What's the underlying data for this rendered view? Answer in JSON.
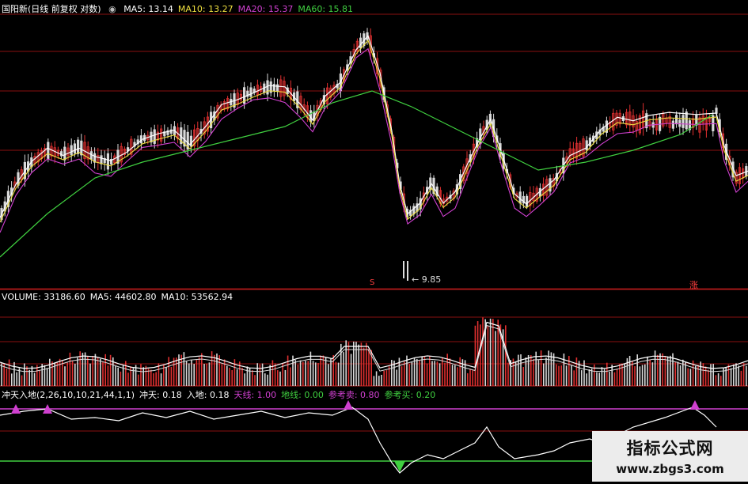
{
  "price_panel": {
    "title": "国阳新(日线 前复权 对数)",
    "ma_labels": [
      {
        "text": "MA5: 13.14",
        "color": "#ffffff"
      },
      {
        "text": "MA10: 13.27",
        "color": "#f0e040"
      },
      {
        "text": "MA20: 15.37",
        "color": "#d040d0"
      },
      {
        "text": "MA60: 15.81",
        "color": "#40d040"
      }
    ],
    "low_marker": "9.85",
    "marker_left": "S",
    "marker_right": "涨"
  },
  "volume_panel": {
    "labels": [
      {
        "text": "VOLUME: 33186.60",
        "color": "#ffffff"
      },
      {
        "text": "MA5: 44602.80",
        "color": "#ffffff"
      },
      {
        "text": "MA10: 53562.94",
        "color": "#ffffff"
      }
    ]
  },
  "indicator_panel": {
    "labels": [
      {
        "text": "冲天入地(2,26,10,10,21,44,1,1)",
        "color": "#ffffff"
      },
      {
        "text": "冲天: 0.18",
        "color": "#ffffff"
      },
      {
        "text": "入地: 0.18",
        "color": "#ffffff"
      },
      {
        "text": "天线: 1.00",
        "color": "#d040d0"
      },
      {
        "text": "地线: 0.00",
        "color": "#40d040"
      },
      {
        "text": "参考卖: 0.80",
        "color": "#d040d0"
      },
      {
        "text": "参考买: 0.20",
        "color": "#40d040"
      }
    ]
  },
  "watermark": {
    "title": "指标公式网",
    "url": "www.zbgs3.com"
  },
  "colors": {
    "up": "#e03030",
    "down": "#d8d8d8",
    "ma5": "#ffffff",
    "ma10": "#f0e040",
    "ma20": "#d040d0",
    "ma60": "#40d040",
    "grid": "#8a1010"
  },
  "chart_data": {
    "type": "candlestick",
    "series": [
      {
        "name": "MA5",
        "value": 13.14
      },
      {
        "name": "MA10",
        "value": 13.27
      },
      {
        "name": "MA20",
        "value": 15.37
      },
      {
        "name": "MA60",
        "value": 15.81
      }
    ],
    "annotations": [
      "9.85"
    ]
  }
}
